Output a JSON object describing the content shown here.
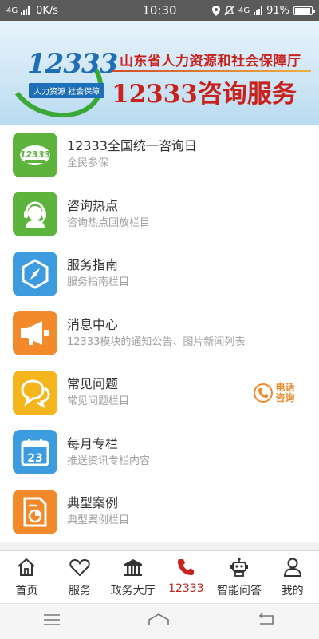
{
  "status_bar": {
    "network": "4G",
    "speed": "0K/s",
    "time": "10:30",
    "network_right": "4G",
    "battery": "91%"
  },
  "banner": {
    "logo_number": "12333",
    "logo_sub": "人力资源 社会保障",
    "headline": "山东省人力资源和社会保障厅",
    "title": "12333咨询服务"
  },
  "list_items": [
    {
      "title": "12333全国统一咨询日",
      "subtitle": "全民参保",
      "icon": "12333-logo-icon",
      "color": "#5cb43c"
    },
    {
      "title": "咨询热点",
      "subtitle": "咨询热点回放栏目",
      "icon": "headset-agent-icon",
      "color": "#5cb43c"
    },
    {
      "title": "服务指南",
      "subtitle": "服务指南栏目",
      "icon": "compass-icon",
      "color": "#3d9be0"
    },
    {
      "title": "消息中心",
      "subtitle": "12333模块的通知公告、图片新闻列表",
      "icon": "megaphone-icon",
      "color": "#f28a2c"
    },
    {
      "title": "常见问题",
      "subtitle": "常见问题栏目",
      "icon": "chat-bubbles-icon",
      "color": "#f5b51c"
    },
    {
      "title": "每月专栏",
      "subtitle": "推送资讯专栏内容",
      "icon": "calendar-icon",
      "color": "#3d9be0"
    },
    {
      "title": "典型案例",
      "subtitle": "典型案例栏目",
      "icon": "document-chart-icon",
      "color": "#f28a2c"
    }
  ],
  "phone_cta": {
    "label": "电话咨询"
  },
  "tabs": [
    {
      "label": "首页",
      "icon": "home-icon"
    },
    {
      "label": "服务",
      "icon": "heart-icon"
    },
    {
      "label": "政务大厅",
      "icon": "government-building-icon"
    },
    {
      "label": "12333",
      "icon": "phone-icon",
      "active": true
    },
    {
      "label": "智能问答",
      "icon": "robot-icon"
    },
    {
      "label": "我的",
      "icon": "person-icon"
    }
  ],
  "colors": {
    "accent_red": "#c9221d",
    "green": "#5cb43c",
    "blue": "#3d9be0",
    "orange": "#f28a2c",
    "yellow": "#f5b51c"
  }
}
